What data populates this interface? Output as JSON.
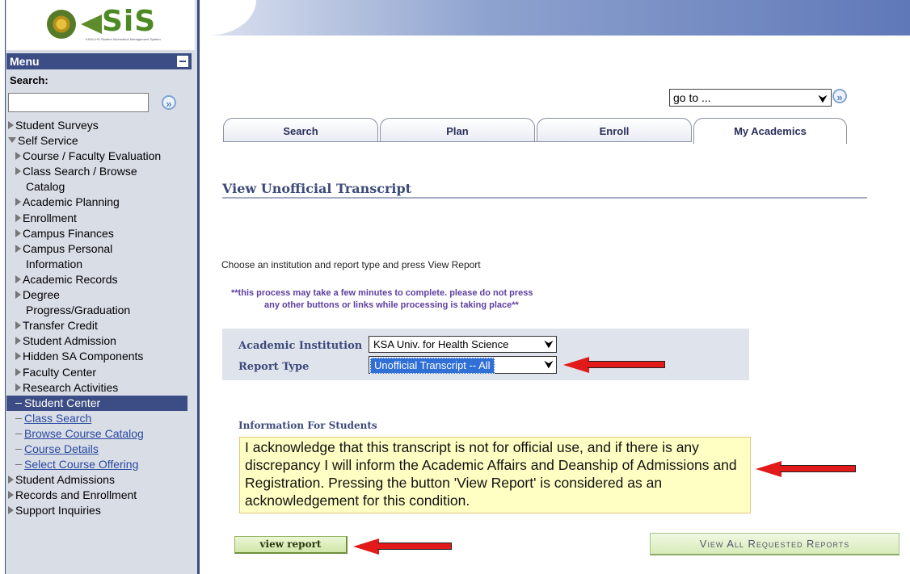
{
  "logo": {
    "text": "SiS",
    "subtitle": "KSAU-HS Student Information Management System"
  },
  "menu": {
    "title": "Menu",
    "search_label": "Search:",
    "search_value": "",
    "items": [
      {
        "label": "Student Surveys",
        "type": "top",
        "icon": "triangle-right-icon"
      },
      {
        "label": "Self Service",
        "type": "top",
        "icon": "triangle-down-icon"
      },
      {
        "label": "Course / Faculty Evaluation",
        "type": "l2"
      },
      {
        "label": "Class Search / Browse",
        "type": "l2"
      },
      {
        "label": "Catalog",
        "type": "cont"
      },
      {
        "label": "Academic Planning",
        "type": "l2"
      },
      {
        "label": "Enrollment",
        "type": "l2"
      },
      {
        "label": "Campus Finances",
        "type": "l2"
      },
      {
        "label": "Campus Personal",
        "type": "l2"
      },
      {
        "label": "Information",
        "type": "cont"
      },
      {
        "label": "Academic Records",
        "type": "l2"
      },
      {
        "label": "Degree",
        "type": "l2"
      },
      {
        "label": "Progress/Graduation",
        "type": "cont"
      },
      {
        "label": "Transfer Credit",
        "type": "l2"
      },
      {
        "label": "Student Admission",
        "type": "l2"
      },
      {
        "label": "Hidden SA Components",
        "type": "l2"
      },
      {
        "label": "Faculty Center",
        "type": "l2"
      },
      {
        "label": "Research Activities",
        "type": "l2"
      },
      {
        "label": "Student Center",
        "type": "sel"
      },
      {
        "label": "Class Search",
        "type": "link"
      },
      {
        "label": "Browse Course Catalog",
        "type": "link"
      },
      {
        "label": "Course Details",
        "type": "link"
      },
      {
        "label": "Select Course Offering",
        "type": "link"
      },
      {
        "label": "Student Admissions",
        "type": "top",
        "icon": "triangle-right-icon"
      },
      {
        "label": "Records and Enrollment",
        "type": "top",
        "icon": "triangle-right-icon"
      },
      {
        "label": "Support Inquiries",
        "type": "top",
        "icon": "triangle-right-icon"
      }
    ]
  },
  "goto": {
    "value": "go to ..."
  },
  "tabs": [
    {
      "label": "Search",
      "active": false
    },
    {
      "label": "Plan",
      "active": false
    },
    {
      "label": "Enroll",
      "active": false
    },
    {
      "label": "My Academics",
      "active": true
    }
  ],
  "page": {
    "title": "View Unofficial Transcript",
    "instructions": "Choose an institution and report type and press View Report",
    "warning_line1": "**this process may take a few minutes to complete. please do not press",
    "warning_line2": "any other buttons or links while processing is taking place**"
  },
  "filters": {
    "institution_label": "Academic Institution",
    "institution_value": "KSA Univ. for Health Science",
    "report_type_label": "Report Type",
    "report_type_value": "Unofficial Transcript -- All"
  },
  "info": {
    "heading": "Information For Students",
    "text": "I acknowledge that this transcript is not for official use, and if there is any discrepancy I will inform the Academic Affairs and Deanship of Admissions and Registration. Pressing the button 'View Report' is considered as an acknowledgement for this condition."
  },
  "buttons": {
    "view_report": "view report",
    "view_all": "View All Requested Reports"
  },
  "colors": {
    "menu_header": "#3c4d85",
    "arrow": "#e21a1a",
    "info_bg": "#ffffc4",
    "button_green": "#cfe6a8"
  }
}
